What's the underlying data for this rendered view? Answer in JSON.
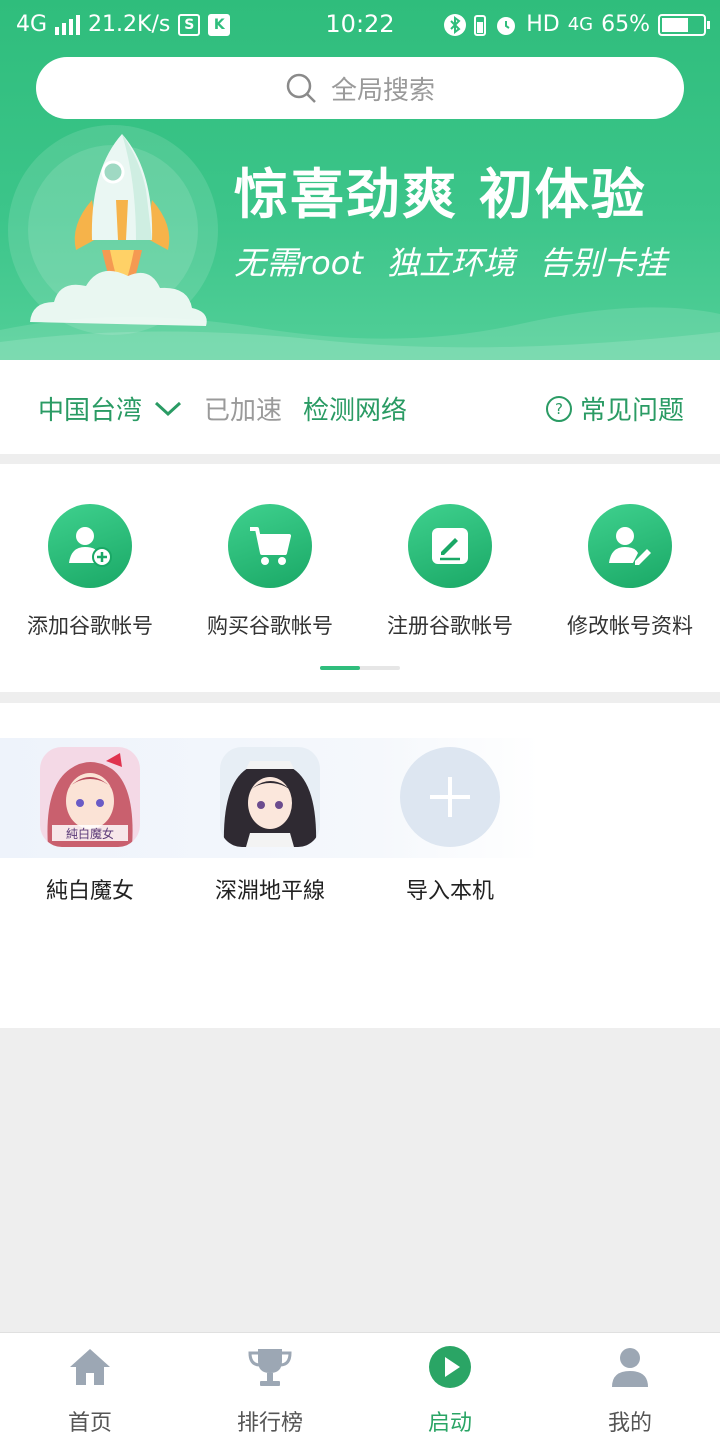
{
  "status_bar": {
    "network": "4G",
    "speed": "21.2K/s",
    "icon_s": "S",
    "icon_k": "K",
    "time": "10:22",
    "hd": "HD",
    "net_type": "4G",
    "battery": "65%",
    "battery_level": 0.65
  },
  "search": {
    "placeholder": "全局搜索"
  },
  "banner": {
    "slogan": "惊喜劲爽  初体验",
    "subtitle": "无需root  独立环境  告别卡挂"
  },
  "region_bar": {
    "region": "中国台湾",
    "accel_status": "已加速",
    "detect": "检测网络",
    "faq": "常见问题",
    "faq_icon_char": "?"
  },
  "quick_actions": {
    "items": [
      {
        "label": "添加谷歌帐号",
        "icon": "add-user-icon"
      },
      {
        "label": "购买谷歌帐号",
        "icon": "cart-icon"
      },
      {
        "label": "注册谷歌帐号",
        "icon": "edit-icon"
      },
      {
        "label": "修改帐号资料",
        "icon": "edit-user-icon"
      }
    ],
    "page": 1,
    "pages": 2
  },
  "apps": {
    "items": [
      {
        "label": "純白魔女",
        "logo_text": "純白魔女"
      },
      {
        "label": "深淵地平線"
      }
    ],
    "add_label": "导入本机"
  },
  "bottom_nav": {
    "items": [
      {
        "label": "首页",
        "icon": "home-icon"
      },
      {
        "label": "排行榜",
        "icon": "trophy-icon"
      },
      {
        "label": "启动",
        "icon": "play-icon",
        "active": true
      },
      {
        "label": "我的",
        "icon": "user-icon"
      }
    ]
  },
  "colors": {
    "brand": "#2fbd7c",
    "brand_text": "#2a9b64",
    "page_bg": "#eeeeee"
  }
}
